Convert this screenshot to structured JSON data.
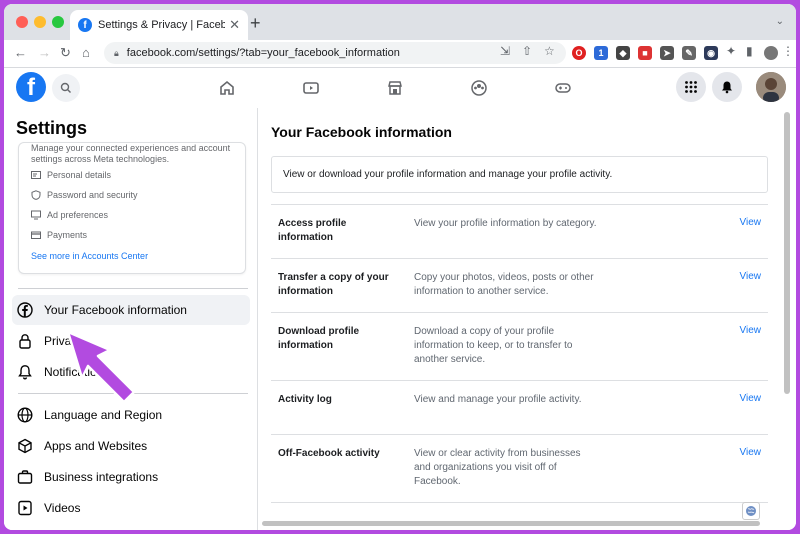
{
  "browser": {
    "tab_title": "Settings & Privacy | Facebook",
    "url": "facebook.com/settings/?tab=your_facebook_information"
  },
  "sidebar": {
    "title": "Settings",
    "accounts_center": {
      "description": "Manage your connected experiences and account settings across Meta technologies.",
      "items": [
        {
          "label": "Personal details",
          "icon": "id-card-icon"
        },
        {
          "label": "Password and security",
          "icon": "shield-icon"
        },
        {
          "label": "Ad preferences",
          "icon": "monitor-icon"
        },
        {
          "label": "Payments",
          "icon": "credit-card-icon"
        }
      ],
      "link": "See more in Accounts Center"
    },
    "nav": [
      {
        "label": "Your Facebook information",
        "icon": "facebook-icon",
        "active": true
      },
      {
        "label": "Privacy",
        "icon": "lock-icon"
      },
      {
        "label": "Notifications",
        "icon": "bell-icon"
      },
      {
        "label": "Language and Region",
        "icon": "globe-icon"
      },
      {
        "label": "Apps and Websites",
        "icon": "cube-icon"
      },
      {
        "label": "Business integrations",
        "icon": "briefcase-icon"
      },
      {
        "label": "Videos",
        "icon": "video-icon"
      }
    ]
  },
  "main": {
    "title": "Your Facebook information",
    "intro": "View or download your profile information and manage your profile activity.",
    "rows": [
      {
        "label": "Access profile information",
        "desc": "View your profile information by category.",
        "action": "View"
      },
      {
        "label": "Transfer a copy of your information",
        "desc": "Copy your photos, videos, posts or other information to another service.",
        "action": "View"
      },
      {
        "label": "Download profile information",
        "desc": "Download a copy of your profile information to keep, or to transfer to another service.",
        "action": "View"
      },
      {
        "label": "Activity log",
        "desc": "View and manage your profile activity.",
        "action": "View"
      },
      {
        "label": "Off-Facebook activity",
        "desc": "View or clear activity from businesses and organizations you visit off of Facebook.",
        "action": "View"
      }
    ]
  },
  "colors": {
    "facebook_blue": "#1877f2",
    "annotation_arrow": "#b24be0"
  }
}
